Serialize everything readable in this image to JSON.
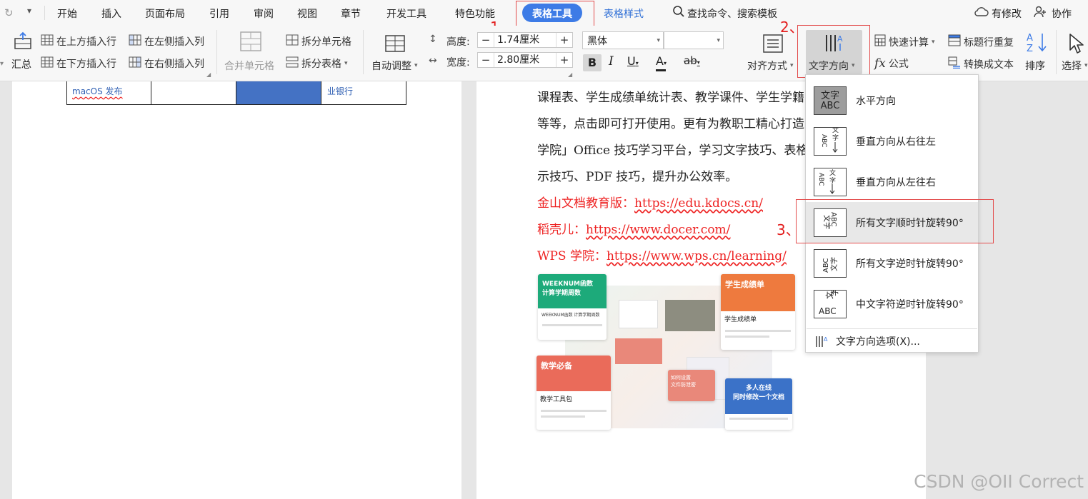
{
  "menubar": {
    "tabs": [
      "开始",
      "插入",
      "页面布局",
      "引用",
      "审阅",
      "视图",
      "章节",
      "开发工具",
      "特色功能"
    ],
    "active_tab": "表格工具",
    "style_tab": "表格样式",
    "search_label": "查找命令、搜索模板",
    "modified_label": "有修改",
    "collab_label": "协作"
  },
  "ribbon": {
    "summary": "汇总",
    "insert_row_above": "在上方插入行",
    "insert_row_below": "在下方插入行",
    "insert_col_left": "在左侧插入列",
    "insert_col_right": "在右侧插入列",
    "merge_cells": "合并单元格",
    "split_cells": "拆分单元格",
    "split_table": "拆分表格",
    "autofit": "自动调整",
    "height_label": "高度:",
    "height_value": "1.74厘米",
    "width_label": "宽度:",
    "width_value": "2.80厘米",
    "font_name": "黑体",
    "font_size": "",
    "align": "对齐方式",
    "text_direction": "文字方向",
    "quick_calc": "快速计算",
    "formula": "公式",
    "repeat_header": "标题行重复",
    "to_text": "转换成文本",
    "sort": "排序",
    "select": "选择"
  },
  "annotations": {
    "step1": "1、",
    "step2": "2、",
    "step3": "3、"
  },
  "table": {
    "cell1": "macOS 发布",
    "cell4": "业银行"
  },
  "document": {
    "lines": [
      "课程表、学生成绩单统计表、教学课件、学生学籍",
      "等等，点击即可打开使用。更有为教职工精心打造",
      "学院」Office 技巧学习平台，学习文字技巧、表格",
      "示技巧、PDF 技巧，提升办公效率。"
    ],
    "links": [
      {
        "label": "金山文档教育版：",
        "url": "https://edu.kdocs.cn/"
      },
      {
        "label": "稻壳儿：",
        "url": "https://www.docer.com/"
      },
      {
        "label": "WPS 学院：",
        "url": "https://www.wps.cn/learning/"
      }
    ],
    "thumbs": {
      "t1_title": "WEEKNUM函数\n计算学期周数",
      "t1_sub": "WEEKNUM函数 计算学期周数",
      "t2_title": "学生成绩单",
      "t2_sub": "学生成绩单",
      "t3_title": "教学必备",
      "t3_sub": "教学工具包",
      "t4_title": "多人在线\n同时修改一个文档",
      "t5_title": "如何设置\n文件防泄密"
    }
  },
  "dropdown": {
    "items": [
      {
        "label": "水平方向",
        "icon_name": "horizontal-text-icon",
        "icon_text": "文字\nABC"
      },
      {
        "label": "垂直方向从右往左",
        "icon_name": "vertical-rtl-icon",
        "icon_text": "ABC\n文字"
      },
      {
        "label": "垂直方向从左往右",
        "icon_name": "vertical-ltr-icon",
        "icon_text": "文字\nABC"
      },
      {
        "label": "所有文字顺时针旋转90°",
        "icon_name": "rotate-cw-icon",
        "icon_text": "ABC\n文字"
      },
      {
        "label": "所有文字逆时针旋转90°",
        "icon_name": "rotate-ccw-icon",
        "icon_text": "ABC\n文字"
      },
      {
        "label": "中文字符逆时针旋转90°",
        "icon_name": "cjk-rotate-ccw-icon",
        "icon_text": "文字\nABC"
      }
    ],
    "options_label": "文字方向选项(X)..."
  },
  "watermark": "CSDN @OII Correct",
  "colors": {
    "accent": "#3d7be6",
    "annotation_red": "#e31e1e",
    "table_fill": "#4472c4"
  }
}
